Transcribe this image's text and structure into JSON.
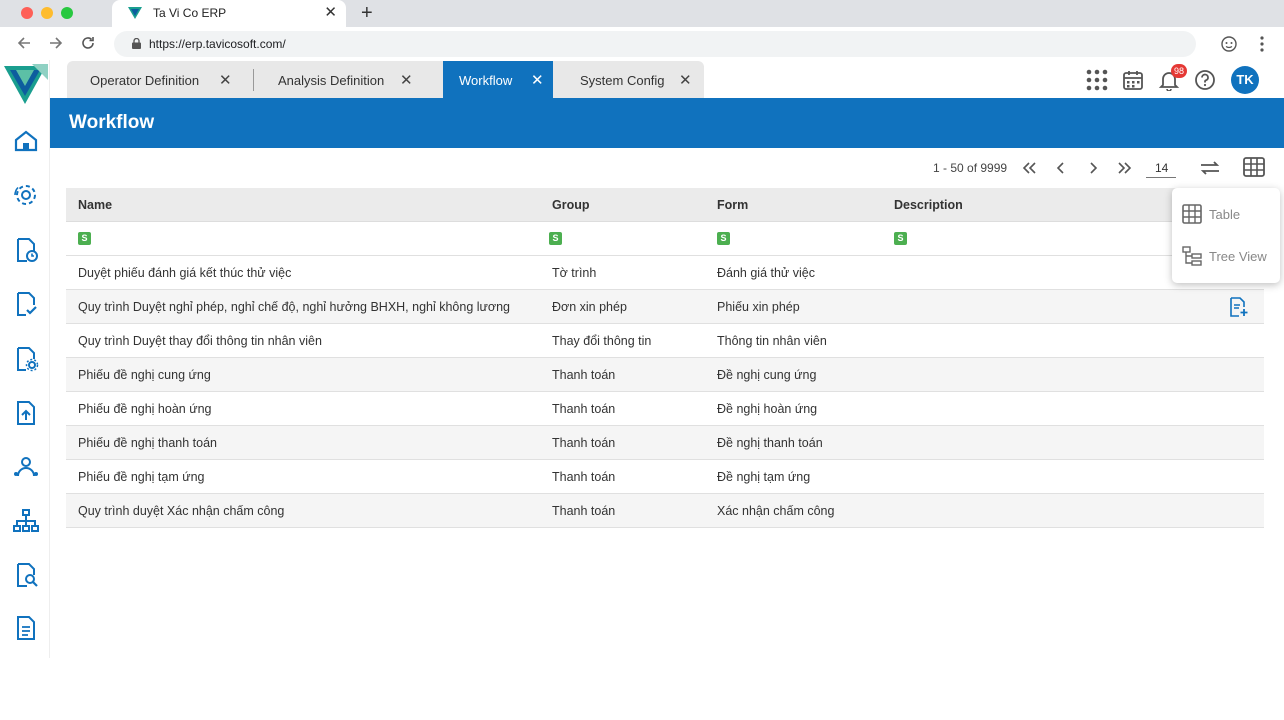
{
  "browser": {
    "tab_title": "Ta Vi Co ERP",
    "tab_close": "✕",
    "new_tab": "+",
    "url": "https://erp.tavicosoft.com/"
  },
  "app": {
    "tabs": [
      {
        "label": "Operator Definition",
        "close": "✕",
        "active": false
      },
      {
        "label": "Analysis Definition",
        "close": "✕",
        "active": false
      },
      {
        "label": "Workflow",
        "close": "✕",
        "active": true
      },
      {
        "label": "System Config",
        "close": "✕",
        "active": false
      }
    ],
    "notifications_count": "98",
    "user_initials": "TK",
    "page_title": "Workflow",
    "accent_color": "#1072be"
  },
  "pager": {
    "range_text": "1 - 50 of 9999",
    "page_size": "14"
  },
  "table": {
    "columns": [
      "Name",
      "Group",
      "Form",
      "Description"
    ],
    "filter_badge": "S",
    "rows": [
      {
        "name": "Duyệt phiếu đánh giá kết thúc thử việc",
        "group": "Tờ trình",
        "form": "Đánh giá thử việc",
        "description": ""
      },
      {
        "name": "Quy trình Duyệt nghỉ phép, nghỉ chế độ, nghỉ hưởng BHXH, nghỉ không lương",
        "group": "Đơn xin phép",
        "form": "Phiếu xin phép",
        "description": ""
      },
      {
        "name": "Quy trình Duyệt thay đổi thông tin nhân viên",
        "group": "Thay đổi thông tin",
        "form": "Thông tin nhân viên",
        "description": ""
      },
      {
        "name": "Phiếu đề nghị cung ứng",
        "group": "Thanh toán",
        "form": "Đề nghị cung ứng",
        "description": ""
      },
      {
        "name": "Phiếu đề nghị hoàn ứng",
        "group": "Thanh toán",
        "form": "Đề nghị hoàn ứng",
        "description": ""
      },
      {
        "name": "Phiếu đề nghị thanh toán",
        "group": "Thanh toán",
        "form": "Đề nghị thanh toán",
        "description": ""
      },
      {
        "name": "Phiếu đề nghị tạm ứng",
        "group": "Thanh toán",
        "form": "Đề nghị tạm ứng",
        "description": ""
      },
      {
        "name": "Quy trình duyệt Xác nhận chấm công",
        "group": "Thanh toán",
        "form": "Xác nhận chấm công",
        "description": ""
      }
    ]
  },
  "view_menu": {
    "items": [
      {
        "label": "Table",
        "icon": "table-icon"
      },
      {
        "label": "Tree View",
        "icon": "tree-view-icon"
      }
    ]
  },
  "sidebar": {
    "icons": [
      "home-icon",
      "settings-cycle-icon",
      "document-clock-icon",
      "document-check-icon",
      "document-gear-icon",
      "document-upload-icon",
      "user-network-icon",
      "org-chart-icon",
      "document-search-icon",
      "document-icon"
    ]
  }
}
